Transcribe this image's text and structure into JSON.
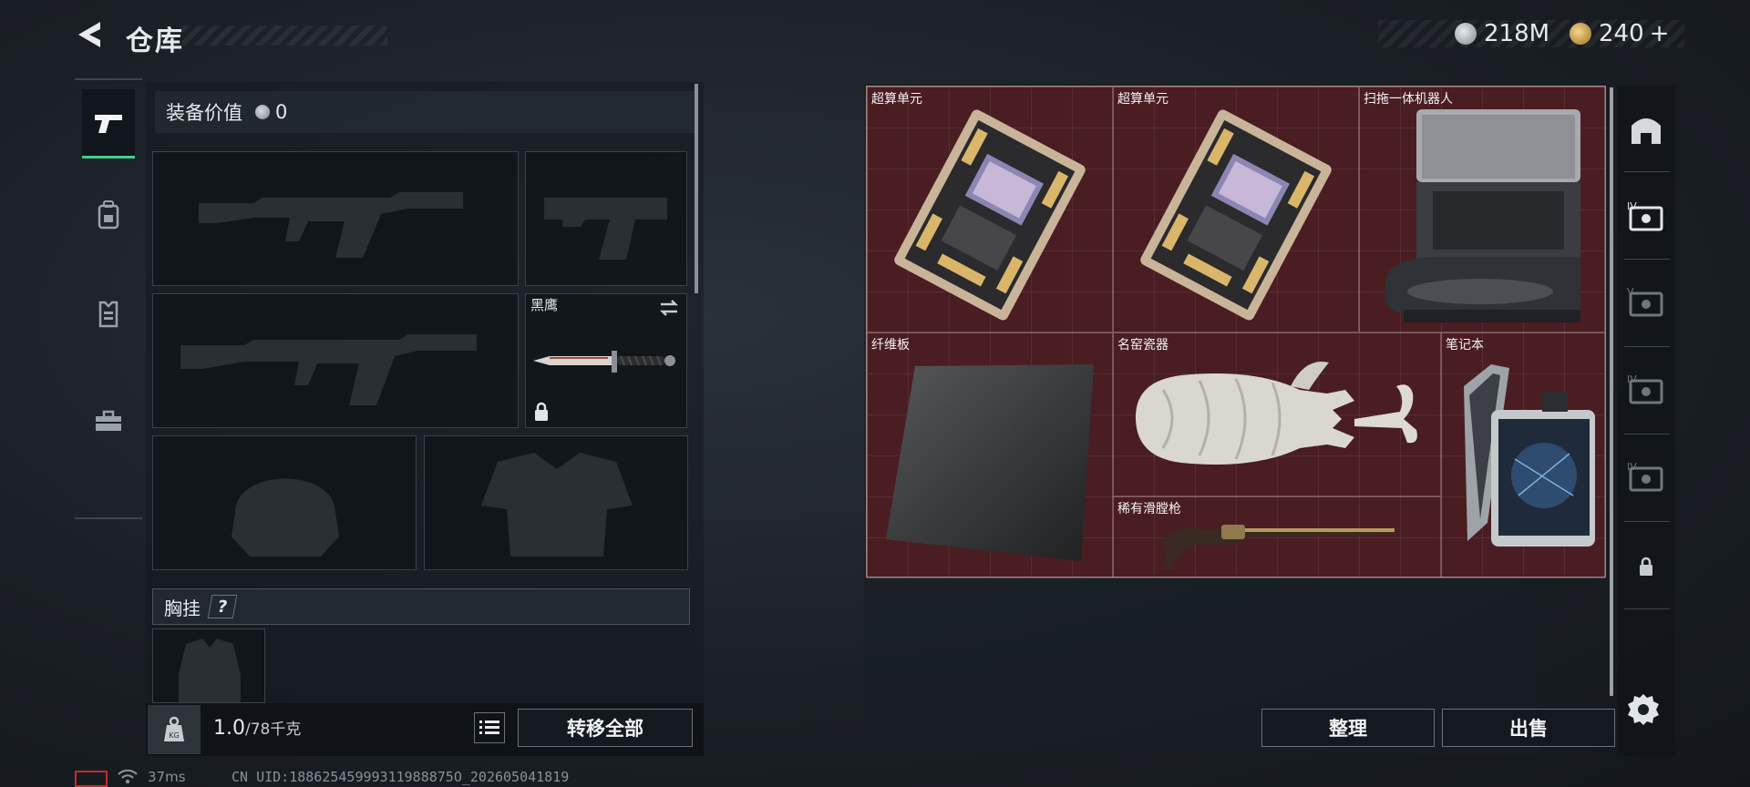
{
  "header": {
    "title": "仓库",
    "silver_amount": "218M",
    "gold_amount": "240",
    "gold_plus": "+"
  },
  "left_tabs": [
    "weapon",
    "backpack",
    "armor",
    "toolbox"
  ],
  "loadout": {
    "value_label": "装备价值",
    "value_amount": "0",
    "knife_name": "黑鹰",
    "chest_rig_label": "胸挂",
    "chest_rig_help": "?"
  },
  "bottom": {
    "weight_current": "1.0",
    "weight_capacity": "/78千克",
    "transfer_all": "转移全部",
    "organize": "整理",
    "sell": "出售"
  },
  "status": {
    "ping": "37ms",
    "uid": "CN UID:18862545999311988875O_202605041819"
  },
  "storage_items": [
    {
      "name": "超算单元"
    },
    {
      "name": "超算单元"
    },
    {
      "name": "扫拖一体机器人"
    },
    {
      "name": "纤维板"
    },
    {
      "name": "名窑瓷器"
    },
    {
      "name": "稀有滑膛枪"
    },
    {
      "name": "笔记本"
    }
  ],
  "right_tabs": [
    "cabin",
    "case-IV",
    "case-V",
    "case-IV",
    "case-IV",
    "locked"
  ],
  "colors": {
    "grid_bg": "#4a1d22",
    "active_tab_accent": "#3fd08a",
    "battery": "#c92b2b"
  }
}
